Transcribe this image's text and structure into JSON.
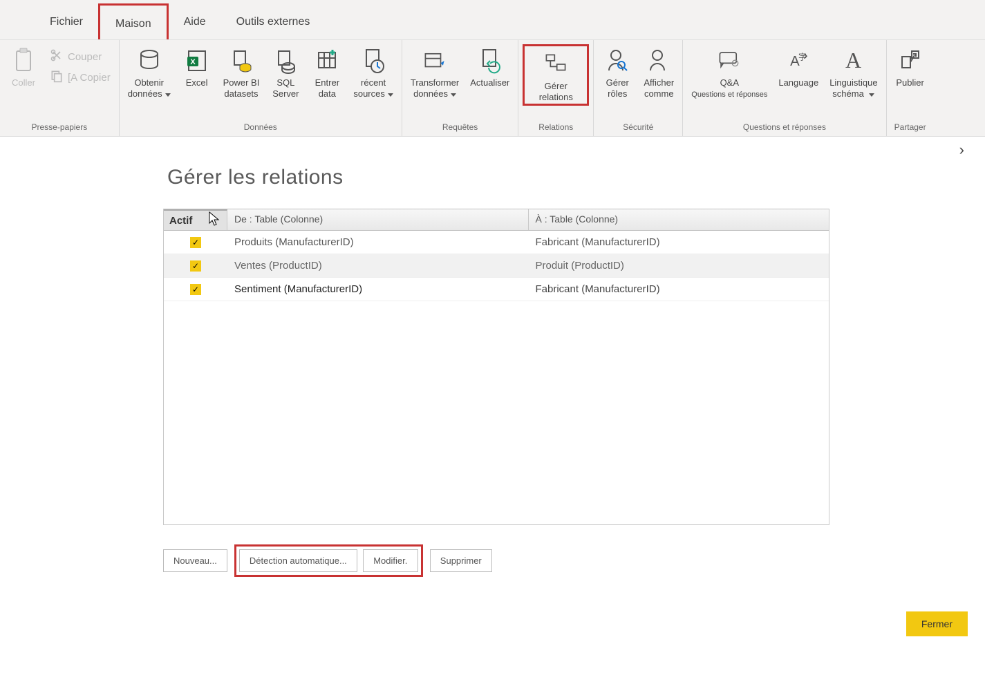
{
  "tabs": {
    "fichier": "Fichier",
    "maison": "Maison",
    "aide": "Aide",
    "outils": "Outils externes"
  },
  "ribbon": {
    "clipboard": {
      "coller": "Coller",
      "couper": "Couper",
      "copier": "[A Copier",
      "group": "Presse-papiers"
    },
    "data": {
      "obtenir1": "Obtenir",
      "obtenir2": "données",
      "excel": "Excel",
      "pbi1": "Power BI",
      "pbi2": "datasets",
      "sql1": "SQL",
      "sql2": "Server",
      "entrer1": "Entrer",
      "entrer2": "data",
      "recent1": "récent",
      "recent2": "sources",
      "group": "Données"
    },
    "queries": {
      "trans1": "Transformer",
      "trans2": "données",
      "actual": "Actualiser",
      "group": "Requêtes"
    },
    "relations": {
      "gerer1": "Gérer",
      "gerer2": "relations",
      "group": "Relations"
    },
    "security": {
      "gerer": "Gérer",
      "roles": "rôles",
      "afficher": "Afficher",
      "comme": "comme",
      "group": "Sécurité"
    },
    "qa": {
      "qa1": "Q&A",
      "qa2": "Questions et réponses",
      "lang": "Language",
      "ling1": "Linguistique",
      "ling2": "schéma",
      "group": "Questions et réponses"
    },
    "share": {
      "publier": "Publier",
      "group": "Partager"
    }
  },
  "dialog": {
    "title": "Gérer les relations",
    "headers": {
      "actif": "Actif",
      "from": "De : Table (Colonne)",
      "to": "À : Table (Colonne)"
    },
    "rows": [
      {
        "from": "Produits (ManufacturerID)",
        "to": "Fabricant (ManufacturerID)"
      },
      {
        "from": "Ventes (ProductID)",
        "to": "Produit (ProductID)"
      },
      {
        "from": "Sentiment (ManufacturerID)",
        "to": "Fabricant (ManufacturerID)"
      }
    ],
    "buttons": {
      "nouveau": "Nouveau...",
      "detection": "Détection automatique...",
      "modifier": "Modifier.",
      "supprimer": "Supprimer",
      "fermer": "Fermer"
    }
  }
}
